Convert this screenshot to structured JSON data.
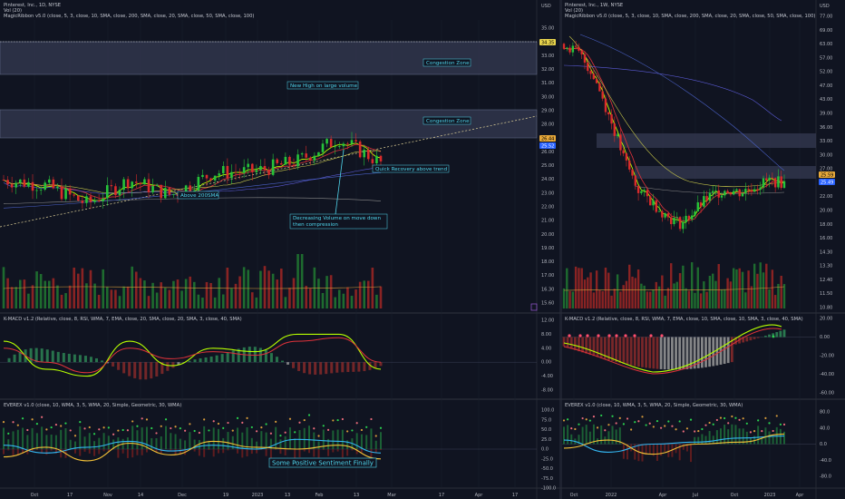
{
  "left": {
    "title": "Pinterest, Inc., 1D, NYSE",
    "vol_label": "Vol (20)",
    "ribbon_label": "MagicRibbon v5.0 (close, 5, 3, close, 10, SMA, close, 200, SMA, close, 20, SMA, close, 50, SMA, close, 100)",
    "currency": "USD",
    "kmacd_label": "K-MACD v1.2 (Relative, close, 8, RSI, WMA, 7, EMA, close, 20, SMA, close, 20, SMA, 3, close, 40, SMA)",
    "everex_label": "EVEREX v1.0 (close, 10, WMA, 3, 5, WMA, 20, Simple, Geometric, 30, WMA)",
    "price_ticks": [
      "35.00",
      "34.00",
      "33.00",
      "32.00",
      "31.00",
      "30.00",
      "29.00",
      "28.00",
      "27.00",
      "26.00",
      "25.00",
      "24.00",
      "23.00",
      "22.00",
      "21.00",
      "20.00",
      "19.00",
      "18.00",
      "17.00",
      "16.30",
      "15.60"
    ],
    "kmacd_ticks": [
      "12.00",
      "8.00",
      "4.00",
      "0.00",
      "-4.00",
      "-8.00"
    ],
    "everex_ticks": [
      "100.0",
      "75.0",
      "50.0",
      "25.0",
      "0.0",
      "-25.0",
      "-50.0",
      "-75.0",
      "-100.0"
    ],
    "time_ticks": [
      "Oct",
      "17",
      "Nov",
      "14",
      "Dec",
      "19",
      "2023",
      "13",
      "Feb",
      "13",
      "Mar",
      "17",
      "Apr",
      "17"
    ],
    "price_badges": [
      "34.35",
      "26.44",
      "25.52"
    ],
    "annotations": {
      "zone_top": "Congestion Zone",
      "new_high": "New High on large volume",
      "zone_mid": "Congestion Zone",
      "recovery": "Quick Recovery above trend",
      "sma200": "Above 200SMA",
      "volume_1": "Decreasing Volume on move down",
      "volume_2": "then compression",
      "sentiment": "Some Positive Sentiment Finally"
    }
  },
  "right": {
    "title": "Pinterest, Inc., 1W, NYSE",
    "vol_label": "Vol (20)",
    "ribbon_label": "MagicRibbon v5.0 (close, 5, 3, close, 10, SMA, close, 200, SMA, close, 20, SMA, close, 50, SMA, close, 100)",
    "currency": "USD",
    "kmacd_label": "K-MACD v1.2 (Relative, close, 8, RSI, WMA, 7, EMA, close, 10, SMA, close, 10, SMA, 3, close, 40, SMA)",
    "everex_label": "EVEREX v1.0 (close, 10, WMA, 3, 5, WMA, 20, Simple, Geometric, 30, WMA)",
    "price_ticks": [
      "77.00",
      "69.00",
      "63.00",
      "57.00",
      "52.00",
      "47.00",
      "43.00",
      "39.00",
      "36.00",
      "33.00",
      "30.00",
      "27.00",
      "24.00",
      "22.00",
      "20.00",
      "18.00",
      "16.00",
      "14.30",
      "13.30",
      "12.40",
      "11.50",
      "10.80"
    ],
    "kmacd_ticks": [
      "20.00",
      "0.00",
      "-20.00",
      "-40.00",
      "-60.00"
    ],
    "everex_ticks": [
      "80.0",
      "40.0",
      "0.0",
      "-40.0",
      "-80.0"
    ],
    "time_ticks": [
      "Oct",
      "2022",
      "Apr",
      "Jul",
      "Oct",
      "2023",
      "Apr"
    ],
    "price_badges": [
      "25.59",
      "25.49"
    ]
  },
  "colors": {
    "background": "#101421",
    "up": "#26c43a",
    "down": "#d92b2b",
    "annotation": "#4fd7ee",
    "sma_purple": "#5b5bd6",
    "sma_yellow": "#c8c84a",
    "kmacd_fast": "#b7ff00",
    "kmacd_slow": "#e0323a"
  },
  "chart_data": [
    {
      "type": "candlestick",
      "panel": "Pinterest, Inc., 1D, NYSE",
      "ylim": [
        15.6,
        35.6
      ],
      "x": [
        "Oct",
        "17",
        "Nov",
        "14",
        "Dec",
        "19",
        "2023",
        "13",
        "Feb",
        "13"
      ],
      "close": [
        24.3,
        23.9,
        22.6,
        24.3,
        23.2,
        24.8,
        24.9,
        25.6,
        27.2,
        25.5
      ],
      "zones": [
        [
          32.8,
          34.35
        ],
        [
          26.6,
          28.0
        ]
      ],
      "volume_ylim": [
        0,
        100
      ]
    },
    {
      "type": "candlestick",
      "panel": "Pinterest, Inc., 1W, NYSE",
      "ylim": [
        10.8,
        77
      ],
      "x": [
        "Oct",
        "2022",
        "Apr",
        "Jul",
        "Oct",
        "2023"
      ],
      "close": [
        64,
        33,
        22,
        19,
        23,
        25.5
      ],
      "zones": [
        [
          30,
          34
        ],
        [
          24.5,
          26.5
        ]
      ]
    },
    {
      "type": "line",
      "panel": "K-MACD 1D",
      "ylim": [
        -10,
        12
      ],
      "x": [
        "Oct",
        "17",
        "Nov",
        "14",
        "Dec",
        "19",
        "2023",
        "13",
        "Feb",
        "13"
      ],
      "series": [
        {
          "values": [
            6,
            -2,
            -4,
            6,
            -1,
            4,
            3,
            8,
            8,
            -2
          ]
        },
        {
          "values": [
            4,
            0,
            -3,
            4,
            1,
            3,
            2,
            6,
            7,
            0
          ]
        }
      ]
    },
    {
      "type": "line",
      "panel": "K-MACD 1W",
      "ylim": [
        -70,
        25
      ],
      "x": [
        "Oct",
        "2022",
        "Apr",
        "Jul",
        "Oct",
        "2023"
      ],
      "series": [
        {
          "values": [
            -5,
            -15,
            -30,
            -15,
            8,
            15
          ]
        },
        {
          "values": [
            -7,
            -18,
            -28,
            -18,
            5,
            12
          ]
        }
      ]
    },
    {
      "type": "line",
      "panel": "EVEREX 1D",
      "ylim": [
        -100,
        110
      ],
      "x": [
        "Oct",
        "17",
        "Nov",
        "14",
        "Dec",
        "19",
        "2023",
        "13",
        "Feb",
        "13"
      ],
      "series": [
        {
          "values": [
            10,
            -10,
            5,
            20,
            -5,
            10,
            0,
            25,
            20,
            -10
          ]
        },
        {
          "values": [
            -20,
            5,
            -30,
            15,
            -15,
            20,
            5,
            0,
            10,
            -25
          ]
        }
      ]
    },
    {
      "type": "line",
      "panel": "EVEREX 1W",
      "ylim": [
        -100,
        110
      ],
      "x": [
        "Oct",
        "2022",
        "Apr",
        "Jul",
        "Oct",
        "2023"
      ],
      "series": [
        {
          "values": [
            10,
            -20,
            0,
            5,
            15,
            20
          ]
        },
        {
          "values": [
            -10,
            10,
            -25,
            0,
            5,
            25
          ]
        }
      ]
    }
  ]
}
